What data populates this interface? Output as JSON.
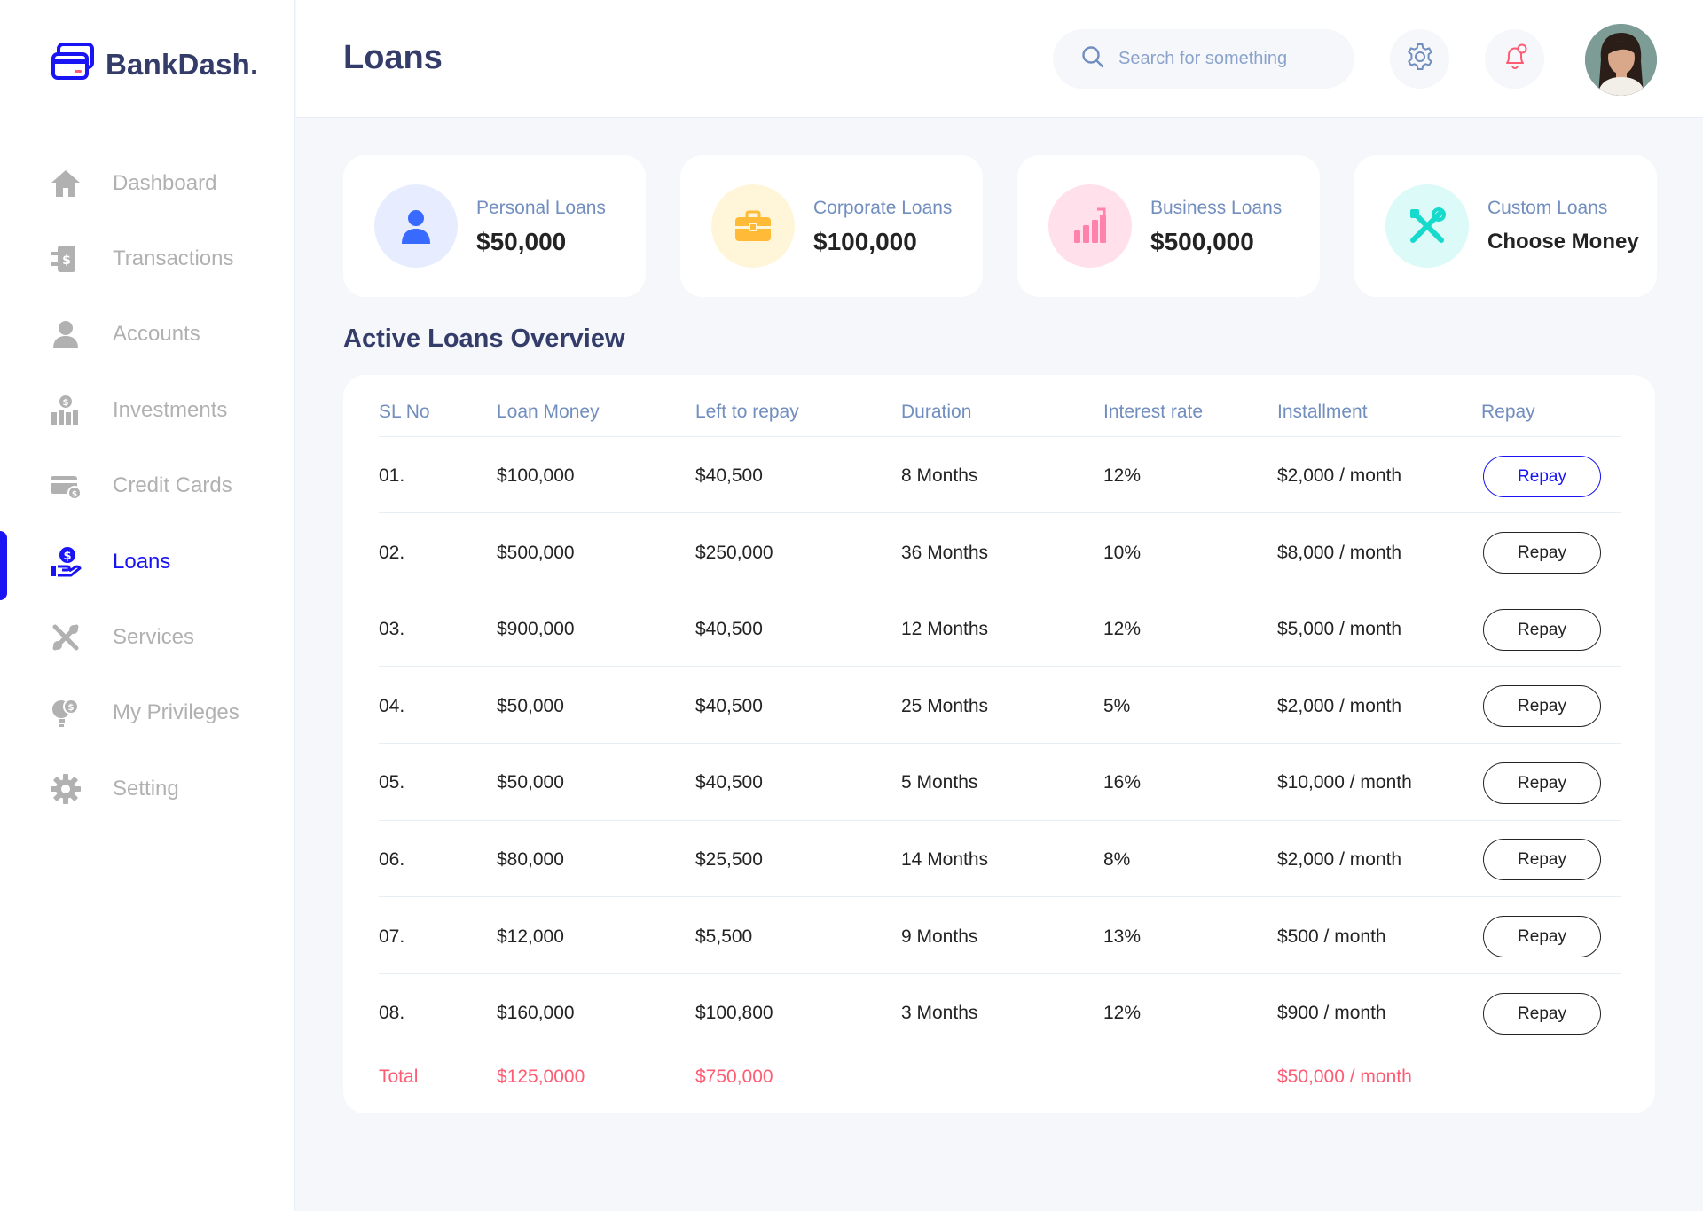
{
  "brand": {
    "name": "BankDash."
  },
  "sidebar": {
    "items": [
      {
        "label": "Dashboard",
        "icon": "home-icon"
      },
      {
        "label": "Transactions",
        "icon": "transfer-icon"
      },
      {
        "label": "Accounts",
        "icon": "user-icon"
      },
      {
        "label": "Investments",
        "icon": "investment-icon"
      },
      {
        "label": "Credit Cards",
        "icon": "credit-card-icon"
      },
      {
        "label": "Loans",
        "icon": "loan-icon",
        "active": true
      },
      {
        "label": "Services",
        "icon": "tools-icon"
      },
      {
        "label": "My Privileges",
        "icon": "privileges-icon"
      },
      {
        "label": "Setting",
        "icon": "gear-icon"
      }
    ]
  },
  "header": {
    "title": "Loans",
    "search_placeholder": "Search for something"
  },
  "cards": [
    {
      "label": "Personal Loans",
      "value": "$50,000",
      "icon": "person-icon",
      "bg": "#E7EDFF",
      "color": "#396AFF"
    },
    {
      "label": "Corporate Loans",
      "value": "$100,000",
      "icon": "briefcase-icon",
      "bg": "#FFF5D9",
      "color": "#FFBB38"
    },
    {
      "label": "Business Loans",
      "value": "$500,000",
      "icon": "growth-chart-icon",
      "bg": "#FFE0EB",
      "color": "#FF82AC"
    },
    {
      "label": "Custom Loans",
      "value": "Choose Money",
      "icon": "tools-icon",
      "bg": "#DCFAF8",
      "color": "#16DBCC"
    }
  ],
  "table": {
    "title": "Active Loans Overview",
    "headers": [
      "SL No",
      "Loan Money",
      "Left to repay",
      "Duration",
      "Interest rate",
      "Installment",
      "Repay"
    ],
    "rows": [
      {
        "sl": "01.",
        "loan": "$100,000",
        "left": "$40,500",
        "duration": "8 Months",
        "rate": "12%",
        "installment": "$2,000 / month",
        "action": "Repay"
      },
      {
        "sl": "02.",
        "loan": "$500,000",
        "left": "$250,000",
        "duration": "36 Months",
        "rate": "10%",
        "installment": "$8,000 / month",
        "action": "Repay"
      },
      {
        "sl": "03.",
        "loan": "$900,000",
        "left": "$40,500",
        "duration": "12 Months",
        "rate": "12%",
        "installment": "$5,000 / month",
        "action": "Repay"
      },
      {
        "sl": "04.",
        "loan": "$50,000",
        "left": "$40,500",
        "duration": "25 Months",
        "rate": "5%",
        "installment": "$2,000 / month",
        "action": "Repay"
      },
      {
        "sl": "05.",
        "loan": "$50,000",
        "left": "$40,500",
        "duration": "5 Months",
        "rate": "16%",
        "installment": "$10,000 / month",
        "action": "Repay"
      },
      {
        "sl": "06.",
        "loan": "$80,000",
        "left": "$25,500",
        "duration": "14 Months",
        "rate": "8%",
        "installment": "$2,000 / month",
        "action": "Repay"
      },
      {
        "sl": "07.",
        "loan": "$12,000",
        "left": "$5,500",
        "duration": "9 Months",
        "rate": "13%",
        "installment": "$500 / month",
        "action": "Repay"
      },
      {
        "sl": "08.",
        "loan": "$160,000",
        "left": "$100,800",
        "duration": "3 Months",
        "rate": "12%",
        "installment": "$900 / month",
        "action": "Repay"
      }
    ],
    "total": {
      "label": "Total",
      "loan": "$125,0000",
      "left": "$750,000",
      "installment": "$50,000 / month"
    }
  },
  "colors": {
    "accent": "#1814F3",
    "title": "#343C6A",
    "muted": "#718EBF",
    "total": "#FE5C73"
  }
}
